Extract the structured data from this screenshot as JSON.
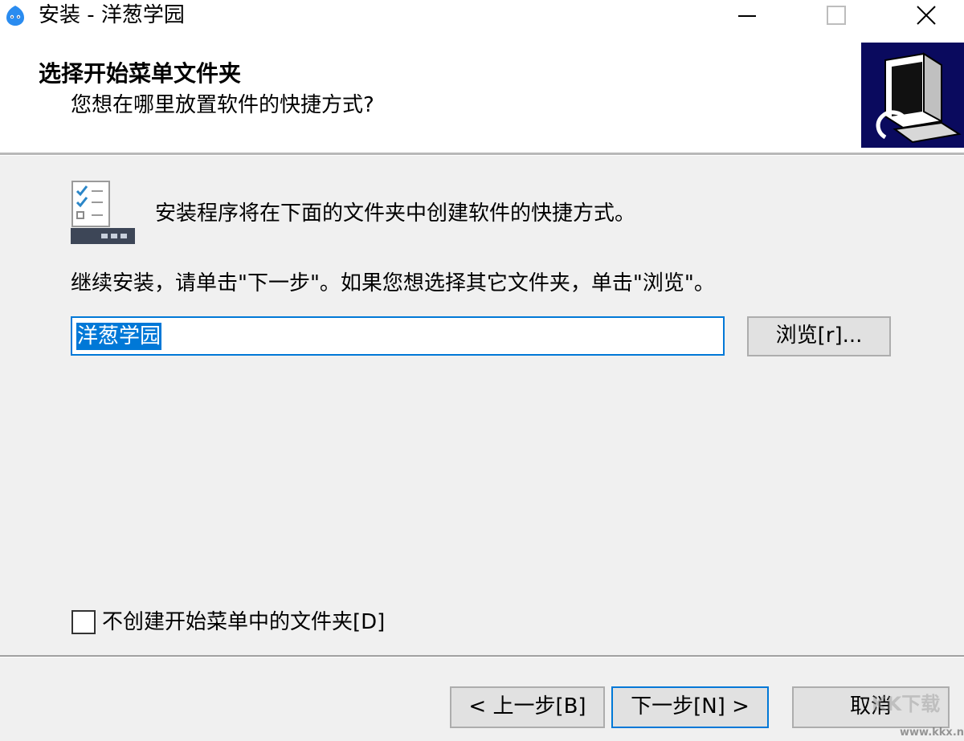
{
  "window": {
    "title": "安装 - 洋葱学园",
    "app_icon": "onion-app-icon",
    "controls": {
      "minimize_icon": "minimize-icon",
      "maximize_icon": "maximize-icon",
      "close_icon": "close-icon"
    }
  },
  "header": {
    "title": "选择开始菜单文件夹",
    "subtitle": "您想在哪里放置软件的快捷方式?",
    "image_icon": "computer-setup-icon",
    "image_bg": "#0a0a5e"
  },
  "content": {
    "folder_icon": "start-menu-folder-icon",
    "info_text": "安装程序将在下面的文件夹中创建软件的快捷方式。",
    "instruction_text": "继续安装，请单击\"下一步\"。如果您想选择其它文件夹，单击\"浏览\"。",
    "folder_value": "洋葱学园",
    "browse_label": "浏览[r]..."
  },
  "options": {
    "no_folder_label": "不创建开始菜单中的文件夹[D]",
    "no_folder_checked": false
  },
  "footer": {
    "back_label": "< 上一步[B]",
    "next_label": "下一步[N] >",
    "cancel_label": "取消"
  },
  "watermark": {
    "text": "KK下载",
    "url": "www.kkx.net"
  },
  "colors": {
    "accent": "#0078d7",
    "button_bg": "#e1e1e1",
    "dialog_bg": "#f0f0f0"
  }
}
